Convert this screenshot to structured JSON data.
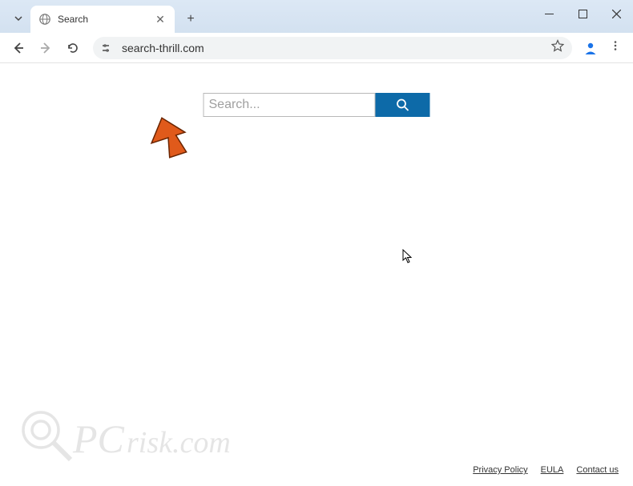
{
  "chrome": {
    "tab": {
      "title": "Search"
    },
    "url": "search-thrill.com",
    "window_controls": {
      "minimize": "–",
      "maximize": "□",
      "close": "✕"
    }
  },
  "page": {
    "search": {
      "placeholder": "Search..."
    },
    "footer": {
      "links": [
        "Privacy Policy",
        "EULA",
        "Contact us"
      ]
    }
  },
  "watermark": {
    "text": "PCrisk.com"
  }
}
